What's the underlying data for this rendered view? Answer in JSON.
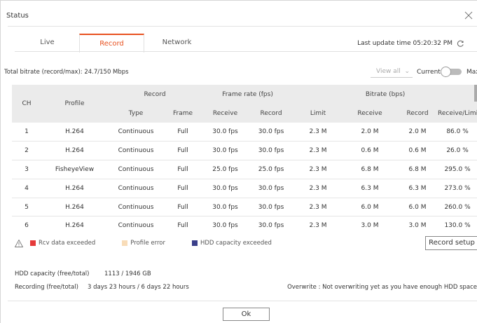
{
  "dialog": {
    "title": "Status",
    "close_icon": "close-icon"
  },
  "tabs": [
    {
      "label": "Live",
      "active": false
    },
    {
      "label": "Record",
      "active": true
    },
    {
      "label": "Network",
      "active": false
    }
  ],
  "last_update": "Last update time 05:20:32 PM",
  "total_bitrate": "Total bitrate (record/max): 24.7/150 Mbps",
  "view_filter": {
    "value": "View all"
  },
  "toggle": {
    "left_label": "Current",
    "right_label": "Max",
    "state": "Current"
  },
  "table": {
    "group_headers": {
      "ch": "CH",
      "profile": "Profile",
      "record": "Record",
      "frame_rate": "Frame rate (fps)",
      "bitrate": "Bitrate (bps)"
    },
    "sub_headers": [
      "Type",
      "Frame",
      "Receive",
      "Record",
      "Limit",
      "Receive",
      "Record",
      "Receive/Limit"
    ],
    "rows": [
      [
        "1",
        "H.264",
        "Continuous",
        "Full",
        "30.0 fps",
        "30.0 fps",
        "2.3 M",
        "2.0 M",
        "2.0 M",
        "86.0 %"
      ],
      [
        "2",
        "H.264",
        "Continuous",
        "Full",
        "30.0 fps",
        "30.0 fps",
        "2.3 M",
        "0.6 M",
        "0.6 M",
        "26.0 %"
      ],
      [
        "3",
        "FisheyeView",
        "Continuous",
        "Full",
        "25.0 fps",
        "25.0 fps",
        "2.3 M",
        "6.8 M",
        "6.8 M",
        "295.0 %"
      ],
      [
        "4",
        "H.264",
        "Continuous",
        "Full",
        "30.0 fps",
        "30.0 fps",
        "2.3 M",
        "6.3 M",
        "6.3 M",
        "273.0 %"
      ],
      [
        "5",
        "H.264",
        "Continuous",
        "Full",
        "30.0 fps",
        "30.0 fps",
        "2.3 M",
        "6.0 M",
        "6.0 M",
        "260.0 %"
      ],
      [
        "6",
        "H.264",
        "Continuous",
        "Full",
        "30.0 fps",
        "30.0 fps",
        "2.3 M",
        "3.0 M",
        "3.0 M",
        "130.0 %"
      ]
    ]
  },
  "legend": {
    "warning_icon": "warning-icon",
    "items": [
      {
        "label": "Rcv data exceeded",
        "color": "#e53a3a"
      },
      {
        "label": "Profile error",
        "color": "#f8dcb8"
      },
      {
        "label": "HDD capacity exceeded",
        "color": "#3a3f8a"
      }
    ]
  },
  "record_setup_label": "Record setup",
  "hdd": {
    "label": "HDD capacity (free/total)",
    "value": "1113 / 1946 GB"
  },
  "recording": {
    "label": "Recording (free/total)",
    "value": "3 days 23 hours / 6 days 22 hours"
  },
  "overwrite": "Overwrite : Not overwriting yet as you have enough HDD space",
  "ok_label": "Ok"
}
